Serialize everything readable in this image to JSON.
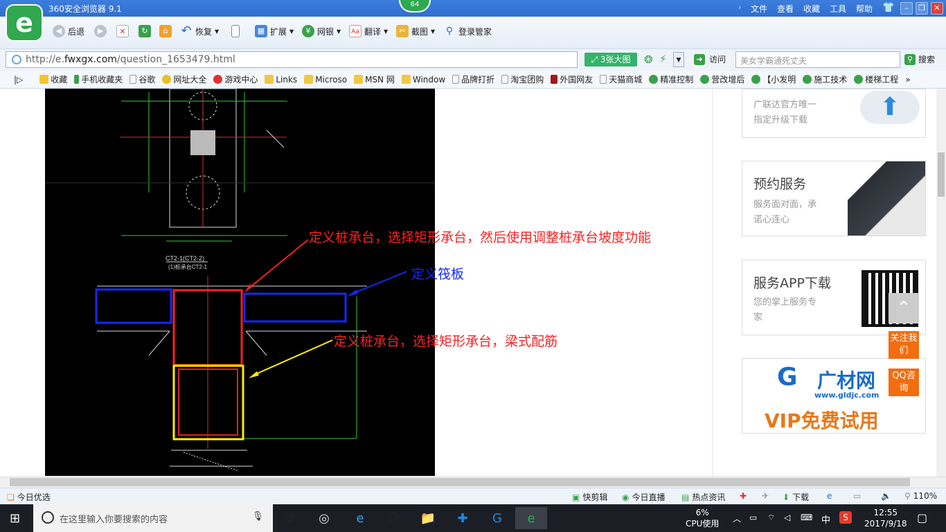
{
  "window": {
    "title": "360安全浏览器 9.1",
    "badge": "64"
  },
  "menu": {
    "items": [
      "文件",
      "查看",
      "收藏",
      "工具",
      "帮助"
    ]
  },
  "toolbar": {
    "back": "后退",
    "restore": "恢复",
    "extend": "扩展",
    "netbank": "网银",
    "translate": "翻译",
    "screenshot": "截图",
    "login": "登录管家"
  },
  "address": {
    "prefix": "http://e.",
    "host": "fwxgx.com",
    "path": "/question_1653479.html",
    "big_image_btn": "3张大图",
    "go": "访问"
  },
  "search": {
    "placeholder": "美女学霸通死丈夫",
    "button": "搜索"
  },
  "bookmarks": [
    "收藏",
    "手机收藏夹",
    "谷歌",
    "网址大全",
    "游戏中心",
    "Links",
    "Microso",
    "MSN 网",
    "Window",
    "品牌打折",
    "淘宝团购",
    "外国网友",
    "天猫商城",
    "精准控制",
    "营改增后",
    "【小发明",
    "施工技术",
    "楼梯工程"
  ],
  "annotations": {
    "a1": "定义桩承台，选择矩形承台，然后使用调整桩承台坡度功能",
    "a2": "定义筏板",
    "a3": "定义桩承台，选择矩形承台，梁式配筋"
  },
  "cad_labels": {
    "l1": "CT2-1(CT2-2)",
    "l2": "(1)桩承台CT2-1"
  },
  "sidebar": {
    "card0": {
      "line1": "广联达官方唯一",
      "line2": "指定升级下载"
    },
    "card1": {
      "title": "预约服务",
      "line1": "服务面对面，承",
      "line2": "诺心连心"
    },
    "card2": {
      "title": "服务APP下载",
      "line1": "您的掌上服务专",
      "line2": "家"
    },
    "card3": {
      "brand": "广材网",
      "url": "www.gldjc.com",
      "vip": "VIP免费试用"
    },
    "follow": "关注我们",
    "qq": "QQ咨询"
  },
  "status": {
    "today": "今日优选",
    "clip": "快剪辑",
    "live": "今日直播",
    "news": "热点资讯",
    "download": "下载",
    "zoom": "110%"
  },
  "taskbar": {
    "search_placeholder": "在这里输入你要搜索的内容",
    "cpu": "6%",
    "cpu_label": "CPU使用",
    "ime": "中",
    "time": "12:55",
    "date": "2017/9/18"
  }
}
